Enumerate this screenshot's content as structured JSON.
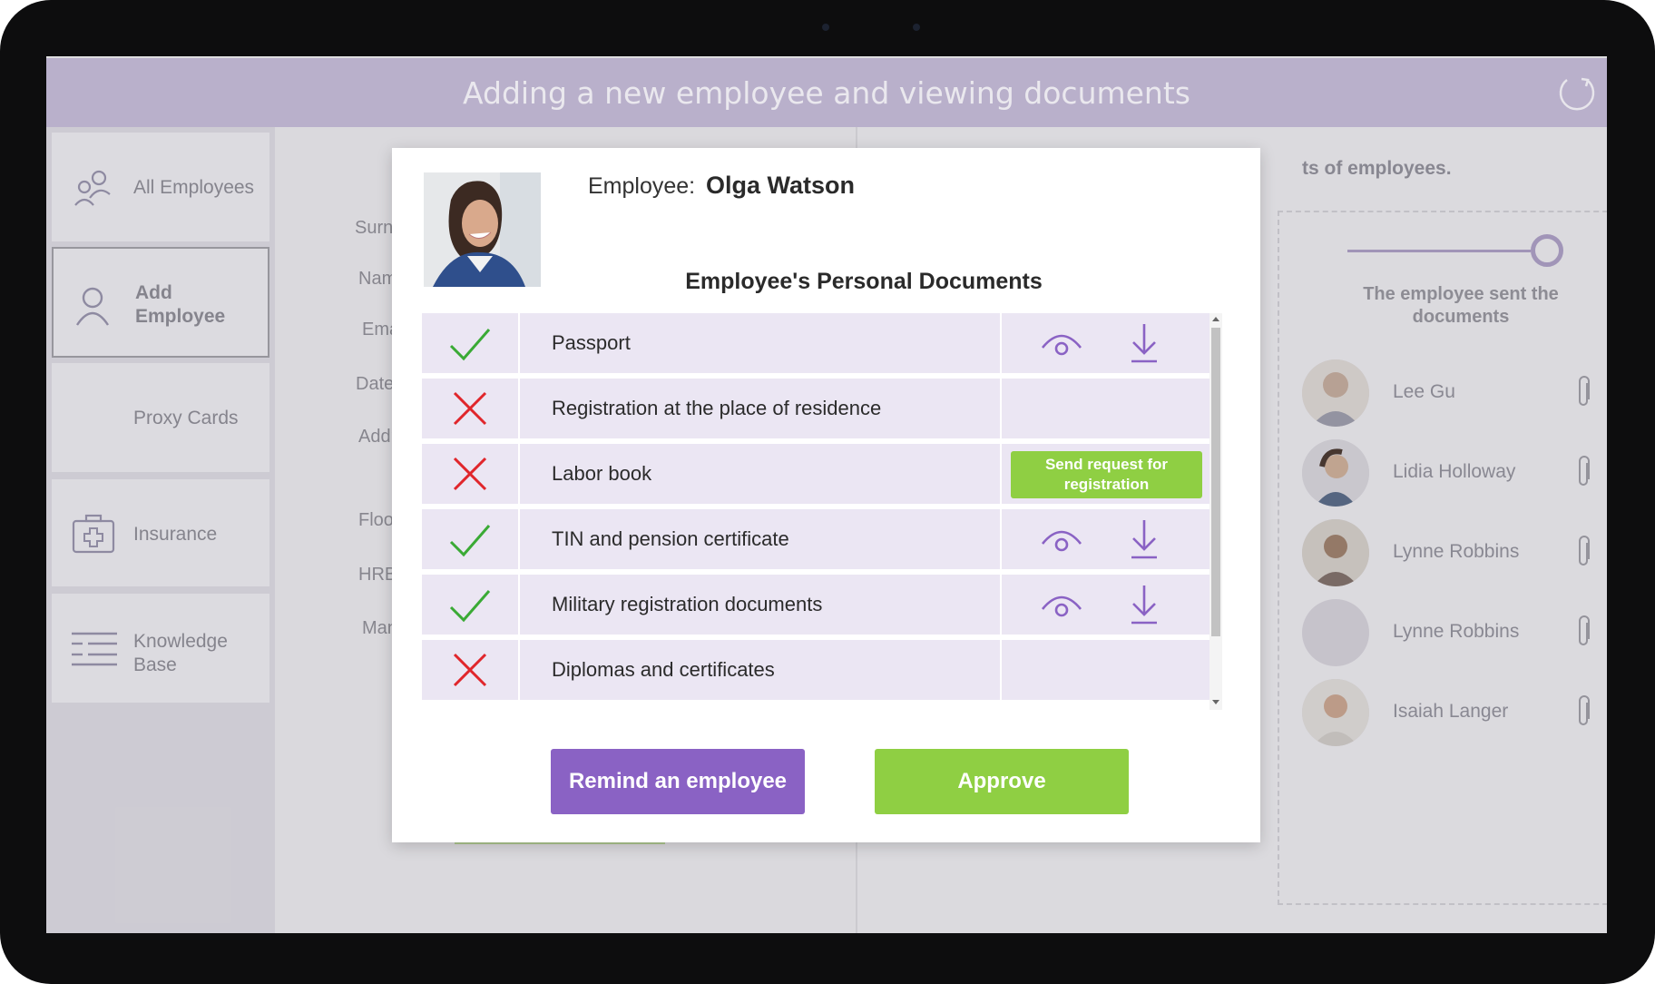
{
  "app": {
    "title": "Adding a new employee and viewing documents"
  },
  "sidebar": {
    "items": [
      {
        "label": "All Employees",
        "icon": "people-icon",
        "active": false
      },
      {
        "label": "Add Employee",
        "icon": "person-icon",
        "active": true
      },
      {
        "label": "Proxy Cards",
        "icon": "",
        "active": false
      },
      {
        "label": "Insurance",
        "icon": "first-aid-icon",
        "active": false
      },
      {
        "label": "Knowledge Base",
        "icon": "list-icon",
        "active": false
      }
    ]
  },
  "form": {
    "labels": [
      "Surname:",
      "Name:",
      "Email:",
      "Date of e",
      "Address:",
      "Floor:",
      "HRBP:",
      "Manager"
    ]
  },
  "right_panel": {
    "heading": "ts of employees.",
    "timeline_text": "The employee sent the documents",
    "employees": [
      {
        "name": "Lee Gu"
      },
      {
        "name": "Lidia Holloway"
      },
      {
        "name": "Lynne Robbins"
      },
      {
        "name": "Lynne Robbins"
      },
      {
        "name": "Isaiah Langer"
      }
    ]
  },
  "modal": {
    "employee_label": "Employee:",
    "employee_name": "Olga Watson",
    "documents_title": "Employee's Personal Documents",
    "documents": [
      {
        "name": "Passport",
        "status": "received",
        "actions": [
          "view",
          "download"
        ]
      },
      {
        "name": "Registration at the place of residence",
        "status": "missing",
        "actions": []
      },
      {
        "name": "Labor book",
        "status": "missing",
        "actions": [
          "request"
        ],
        "request_label": "Send request for registration"
      },
      {
        "name": "TIN and pension certificate",
        "status": "received",
        "actions": [
          "view",
          "download"
        ]
      },
      {
        "name": "Military registration documents",
        "status": "received",
        "actions": [
          "view",
          "download"
        ]
      },
      {
        "name": "Diplomas and certificates",
        "status": "missing",
        "actions": []
      }
    ],
    "remind_button": "Remind an employee",
    "approve_button": "Approve"
  },
  "colors": {
    "header_bg": "#c1b8d4",
    "accent_purple": "#8a62c4",
    "accent_green": "#8fcf43",
    "check_green": "#3aaa35",
    "cross_red": "#e0262b",
    "row_bg": "#ebe6f3"
  }
}
